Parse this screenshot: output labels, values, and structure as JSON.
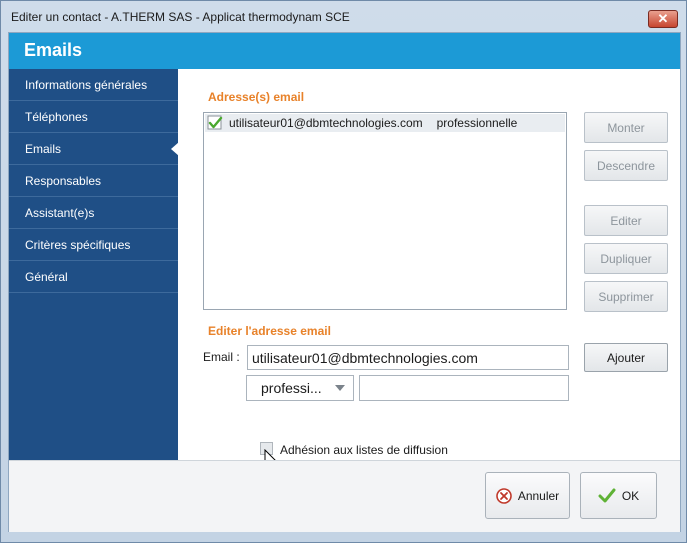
{
  "window": {
    "title": "Editer un contact - A.THERM SAS - Applicat thermodynam SCE",
    "close_symbol": "✕"
  },
  "header": {
    "title": "Emails"
  },
  "sidebar": {
    "items": [
      {
        "label": "Informations générales"
      },
      {
        "label": "Téléphones"
      },
      {
        "label": "Emails"
      },
      {
        "label": "Responsables"
      },
      {
        "label": "Assistant(e)s"
      },
      {
        "label": "Critères spécifiques"
      },
      {
        "label": "Général"
      }
    ],
    "active_index": 2
  },
  "emails_section": {
    "label": "Adresse(s) email",
    "rows": [
      {
        "email": "utilisateur01@dbmtechnologies.com",
        "type": "professionnelle",
        "icon": "checkmark-icon"
      }
    ]
  },
  "list_buttons": {
    "monter": "Monter",
    "descendre": "Descendre",
    "editer": "Editer",
    "dupliquer": "Dupliquer",
    "supprimer": "Supprimer"
  },
  "edit_section": {
    "label": "Editer l'adresse email",
    "email_label": "Email :",
    "email_value": "utilisateur01@dbmtechnologies.com",
    "type_value": "professi...",
    "extra_value": "",
    "add_button": "Ajouter",
    "diffusion_label": "Adhésion aux listes de diffusion",
    "diffusion_checked": false
  },
  "footer": {
    "cancel_label": "Annuler",
    "ok_label": "OK"
  },
  "colors": {
    "header_blue": "#1c9ad6",
    "sidebar_navy": "#1f4f86",
    "section_orange": "#e8822a",
    "ok_green": "#5fb236",
    "cancel_red": "#c0392b"
  }
}
